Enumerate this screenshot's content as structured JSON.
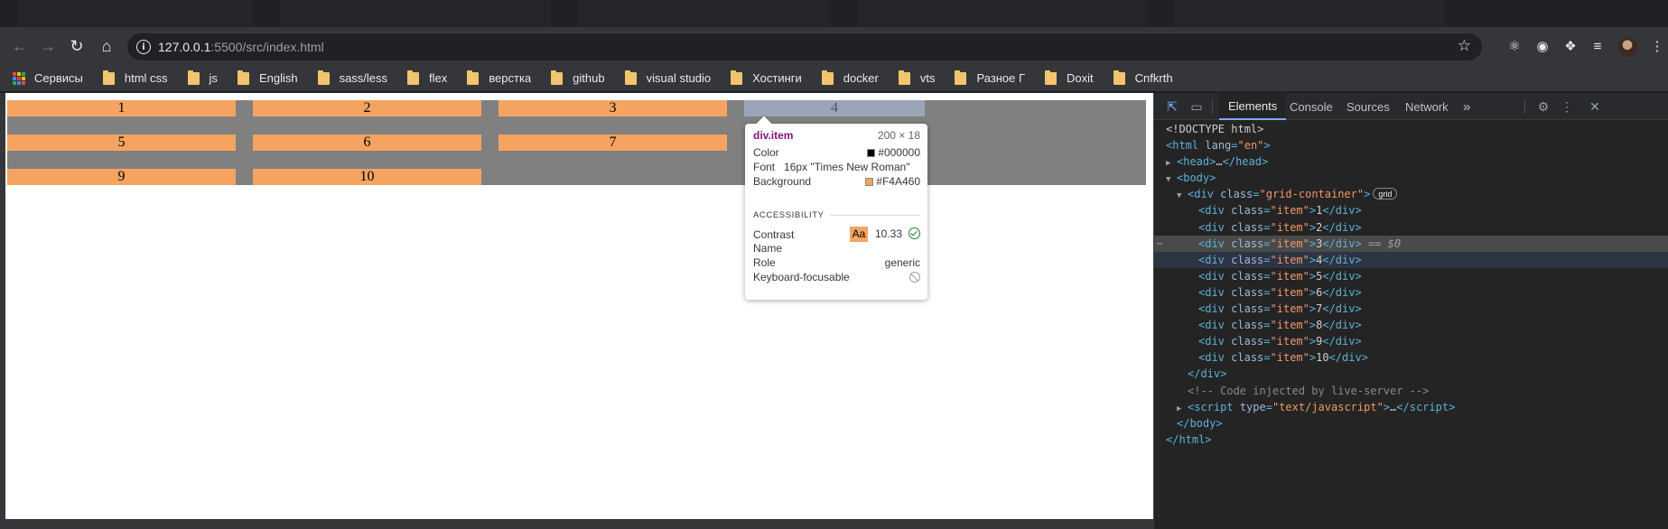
{
  "browser": {
    "url_host": "127.0.0.1",
    "url_path": ":5500/src/index.html",
    "bookmarks": [
      "Сервисы",
      "html css",
      "js",
      "English",
      "sass/less",
      "flex",
      "верстка",
      "github",
      "visual studio",
      "Хостинги",
      "docker",
      "vts",
      "Разное Г",
      "Doxit",
      "Cnfkrth"
    ]
  },
  "page": {
    "items": [
      "1",
      "2",
      "3",
      "4",
      "5",
      "6",
      "7",
      "9",
      "10"
    ],
    "grid_background": "#808080",
    "item_background": "#F4A460"
  },
  "tooltip": {
    "element": "div",
    "class": ".item",
    "size": "200 × 18",
    "color_label": "Color",
    "color_value": "#000000",
    "font_label": "Font",
    "font_value": "16px \"Times New Roman\"",
    "background_label": "Background",
    "background_value": "#F4A460",
    "section": "ACCESSIBILITY",
    "contrast_label": "Contrast",
    "contrast_sample": "Aa",
    "contrast_value": "10.33",
    "name_label": "Name",
    "role_label": "Role",
    "role_value": "generic",
    "keyboard_label": "Keyboard-focusable"
  },
  "devtools": {
    "tabs": [
      "Elements",
      "Console",
      "Sources",
      "Network"
    ],
    "more": "»",
    "doctype": "<!DOCTYPE html>",
    "selected_marker": "== $0",
    "grid_badge": "grid",
    "comment": "<!-- Code injected by live-server -->",
    "lines": {
      "html_open_tag": "html",
      "html_lang_attr": "lang",
      "html_lang_val": "\"en\"",
      "head": "head",
      "head_ellipsis": "…",
      "body": "body",
      "div": "div",
      "class_attr": "class",
      "grid_class": "\"grid-container\"",
      "item_class": "\"item\"",
      "script": "script",
      "type_attr": "type",
      "script_type": "\"text/javascript\"",
      "item_texts": [
        "1",
        "2",
        "3",
        "4",
        "5",
        "6",
        "7",
        "8",
        "9",
        "10"
      ]
    }
  }
}
